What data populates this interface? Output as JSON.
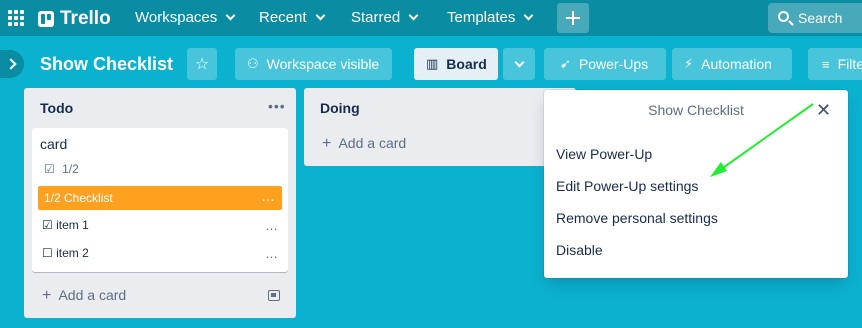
{
  "nav": {
    "logo": "Trello",
    "workspaces": "Workspaces",
    "recent": "Recent",
    "starred": "Starred",
    "templates": "Templates",
    "search": "Search"
  },
  "header": {
    "title": "Show Checklist",
    "visibility": "Workspace visible",
    "board_view": "Board",
    "powerups": "Power-Ups",
    "automation": "Automation",
    "filter": "Filter"
  },
  "lists": [
    {
      "title": "Todo",
      "card": {
        "title": "card",
        "badge": "1/2",
        "checklist": "1/2 Checklist",
        "items": [
          {
            "label": "item 1",
            "checked": true
          },
          {
            "label": "item 2",
            "checked": false
          }
        ]
      },
      "add": "Add a card"
    },
    {
      "title": "Doing",
      "add": "Add a card"
    }
  ],
  "popover": {
    "title": "Show Checklist",
    "items": [
      "View Power-Up",
      "Edit Power-Up settings",
      "Remove personal settings",
      "Disable"
    ]
  },
  "colors": {
    "background": "#0bb2cf",
    "topbar": "#0a8ca3",
    "checklist": "#ffa11e",
    "annotation_arrow": "#22ee33"
  }
}
